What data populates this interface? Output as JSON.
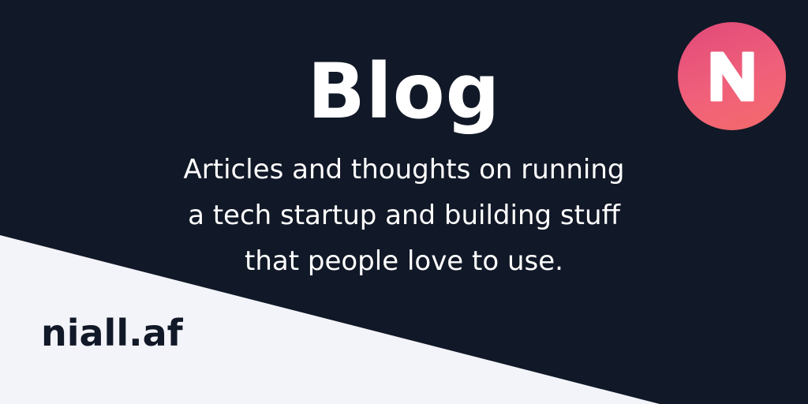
{
  "header": {
    "title": "Blog",
    "subtitle_lines": [
      "Articles and thoughts on running",
      "a tech startup and building stuff",
      "that people love to use."
    ]
  },
  "footer": {
    "site_name": "niall.af"
  },
  "logo": {
    "icon": "n-logo-icon",
    "letter": "N",
    "gradient_start": "#e0497a",
    "gradient_end": "#f46a6a"
  },
  "colors": {
    "background_dark": "#111827",
    "background_light": "#f3f4f9",
    "text_light": "#ffffff",
    "text_dark": "#111827"
  }
}
